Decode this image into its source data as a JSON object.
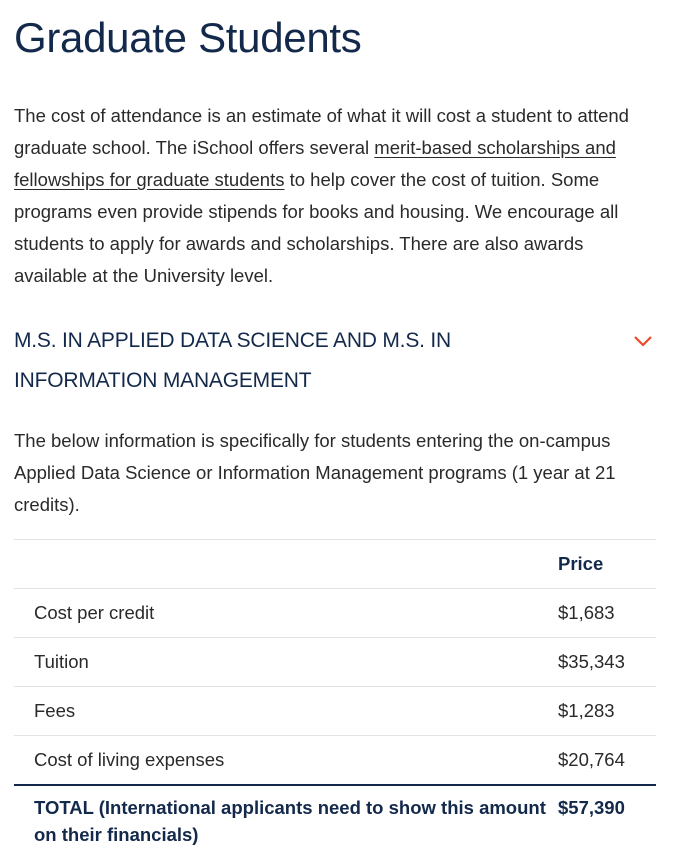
{
  "page": {
    "title": "Graduate Students"
  },
  "intro": {
    "text_before_link": "The cost of attendance is an estimate of what it will cost a student to attend graduate school. The iSchool offers several ",
    "link_text": "merit-based scholarships and fellowships for graduate students",
    "text_after_link": " to help cover the cost of tuition. Some programs even provide stipends for books and housing. We encourage all students to apply for awards and scholarships. There are also awards available at the University level."
  },
  "accordion": {
    "title": "M.S. IN APPLIED DATA SCIENCE AND M.S. IN INFORMATION MANAGEMENT",
    "icon": "chevron-down-icon",
    "description": "The below information is specifically for students entering the on-campus Applied Data Science or Information Management programs (1 year at 21 credits).",
    "table": {
      "header": {
        "label": "",
        "price": "Price"
      },
      "rows": [
        {
          "label": "Cost per credit",
          "price": "$1,683"
        },
        {
          "label": "Tuition",
          "price": "$35,343"
        },
        {
          "label": "Fees",
          "price": "$1,283"
        },
        {
          "label": "Cost of living expenses",
          "price": "$20,764"
        }
      ],
      "total": {
        "label": "TOTAL  (International applicants need to show this amount on their financials)",
        "price": "$57,390"
      }
    }
  },
  "colors": {
    "heading": "#13294b",
    "accent_chevron": "#e84a27",
    "body_text": "#2a2a2a",
    "divider": "#e3e3e3"
  }
}
